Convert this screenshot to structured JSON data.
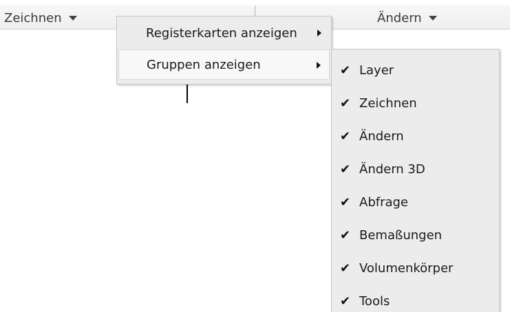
{
  "ribbon": {
    "panels": [
      {
        "label": "Zeichnen",
        "icon": "chevron-down-icon"
      },
      {
        "label": "Ändern",
        "icon": "chevron-down-icon"
      }
    ]
  },
  "context_menu": {
    "items": [
      {
        "label": "Registerkarten anzeigen",
        "has_submenu": true,
        "highlighted": false
      },
      {
        "label": "Gruppen anzeigen",
        "has_submenu": true,
        "highlighted": true
      }
    ]
  },
  "submenu": {
    "check_glyph": "✔",
    "items": [
      {
        "label": "Layer",
        "checked": true
      },
      {
        "label": "Zeichnen",
        "checked": true
      },
      {
        "label": "Ändern",
        "checked": true
      },
      {
        "label": "Ändern 3D",
        "checked": true
      },
      {
        "label": "Abfrage",
        "checked": true
      },
      {
        "label": "Bemaßungen",
        "checked": true
      },
      {
        "label": "Volumenkörper",
        "checked": true
      },
      {
        "label": "Tools",
        "checked": true
      }
    ]
  }
}
